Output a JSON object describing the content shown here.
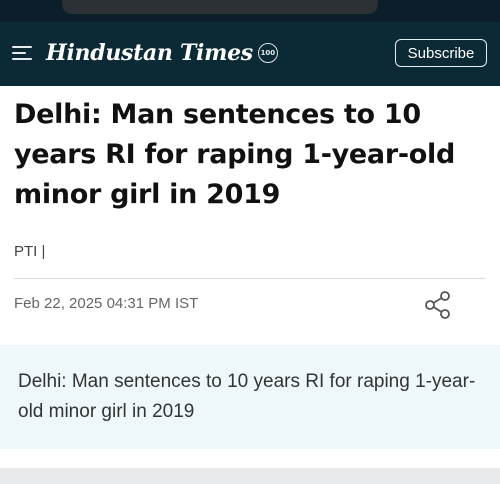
{
  "header": {
    "logo_text": "Hindustan Times",
    "logo_badge": "100",
    "subscribe_label": "Subscribe"
  },
  "article": {
    "headline": "Delhi: Man sentences to 10 years RI for raping 1-year-old minor girl in 2019",
    "byline": "PTI |",
    "dateline": "Feb 22, 2025 04:31 PM IST",
    "summary": "Delhi: Man sentences to 10 years RI for raping 1-year-old minor girl in 2019"
  },
  "colors": {
    "header_bg": "#0c2a36",
    "summary_bg": "#eef8fb"
  },
  "icons": {
    "menu": "hamburger-menu-icon",
    "share": "share-icon"
  }
}
